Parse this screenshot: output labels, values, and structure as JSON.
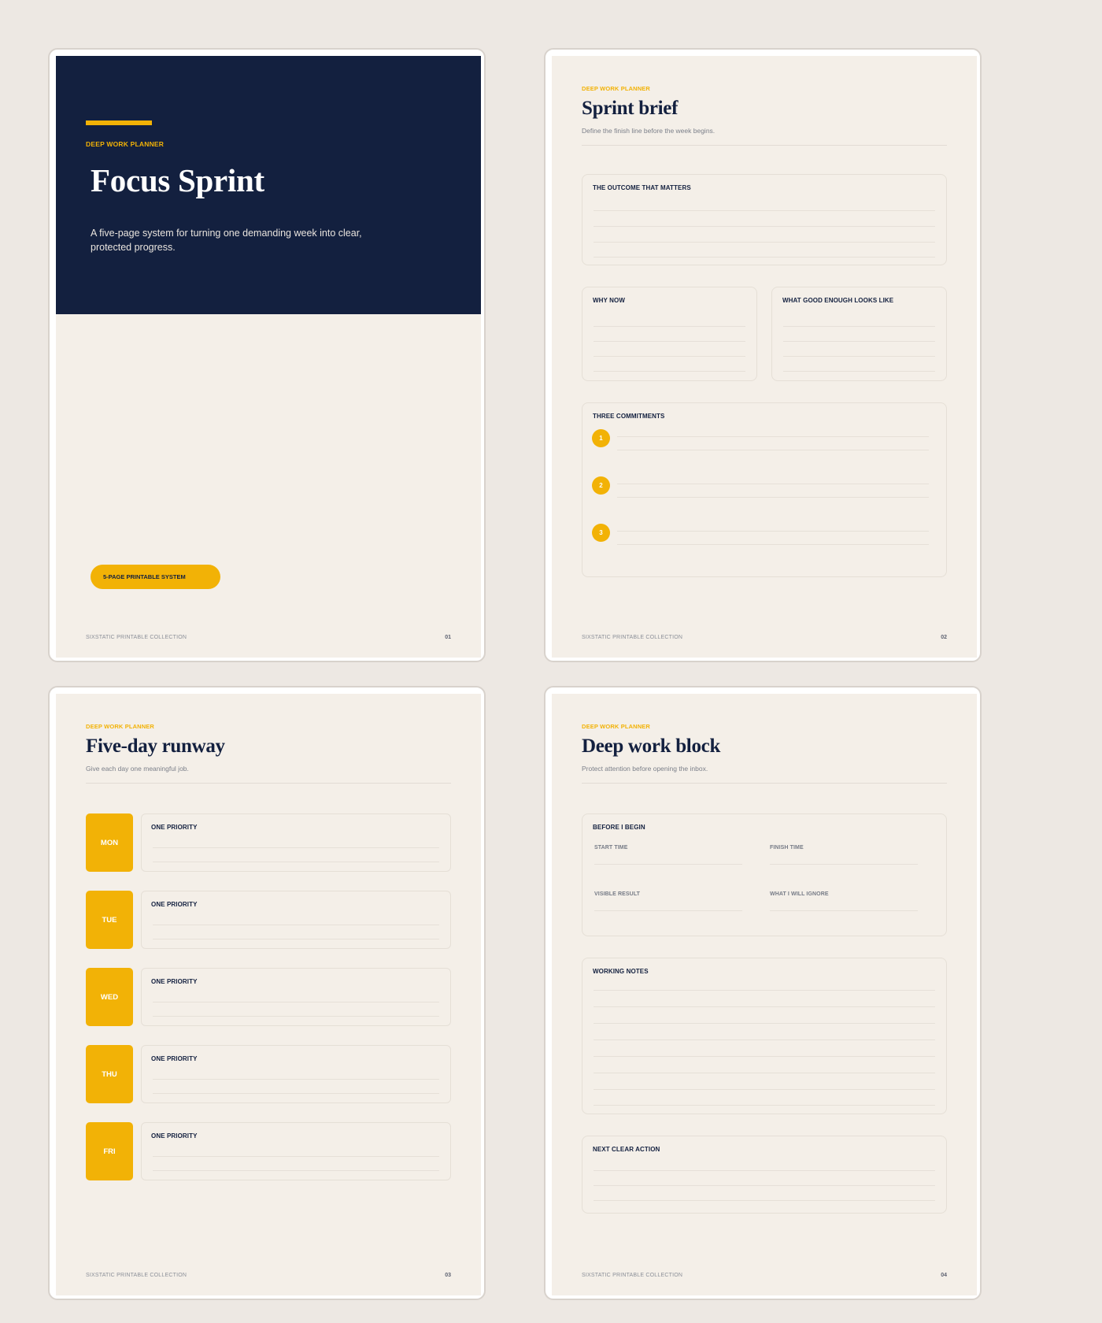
{
  "planner": {
    "eyebrow": "DEEP WORK PLANNER",
    "footer_brand": "SIXSTATIC PRINTABLE COLLECTION"
  },
  "colors": {
    "navy": "#13203f",
    "accent_yellow": "#f2b206",
    "paper": "#f4efe8",
    "background": "#ede8e3"
  },
  "cover": {
    "eyebrow": "DEEP WORK PLANNER",
    "title": "Focus Sprint",
    "description": "A five-page system for turning one demanding week into clear, protected progress.",
    "badge": "5-PAGE PRINTABLE SYSTEM",
    "page_number": "01"
  },
  "brief": {
    "title": "Sprint brief",
    "subtitle": "Define the finish line before the week begins.",
    "outcome_label": "THE OUTCOME THAT MATTERS",
    "why_label": "WHY NOW",
    "good_enough_label": "WHAT GOOD ENOUGH LOOKS LIKE",
    "commitments_label": "THREE COMMITMENTS",
    "commitments": [
      "1",
      "2",
      "3"
    ],
    "page_number": "02"
  },
  "runway": {
    "title": "Five-day runway",
    "subtitle": "Give each day one meaningful job.",
    "priority_label": "ONE PRIORITY",
    "days": [
      "MON",
      "TUE",
      "WED",
      "THU",
      "FRI"
    ],
    "page_number": "03"
  },
  "block": {
    "title": "Deep work block",
    "subtitle": "Protect attention before opening the inbox.",
    "begin_label": "BEFORE I BEGIN",
    "fields": {
      "start_time": "START TIME",
      "finish_time": "FINISH TIME",
      "visible_result": "VISIBLE RESULT",
      "ignore": "WHAT I WILL IGNORE"
    },
    "notes_label": "WORKING NOTES",
    "next_label": "NEXT CLEAR ACTION",
    "page_number": "04"
  }
}
